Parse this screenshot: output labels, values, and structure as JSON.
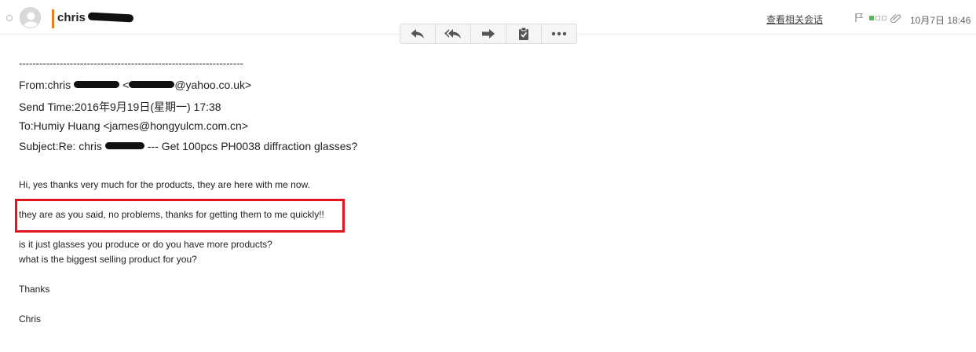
{
  "header": {
    "sender_name": "chris",
    "related_link": "查看相关会话",
    "date": "10月7日 18:46"
  },
  "toolbar": {
    "buttons": [
      {
        "name": "reply",
        "icon": "reply-icon"
      },
      {
        "name": "reply-all",
        "icon": "reply-all-icon"
      },
      {
        "name": "forward",
        "icon": "forward-icon"
      },
      {
        "name": "task",
        "icon": "clipboard-check-icon"
      },
      {
        "name": "more",
        "icon": "more-icon"
      }
    ]
  },
  "quoted": {
    "divider": "------------------------------------------------------------------",
    "from_prefix": "From:chris",
    "from_mid": "<",
    "from_suffix": "@yahoo.co.uk>",
    "send_time": "Send Time:2016年9月19日(星期一) 17:38",
    "to": "To:Humiy Huang <james@hongyulcm.com.cn>",
    "subject_prefix": "Subject:Re: chris",
    "subject_suffix": "--- Get 100pcs PH0038 diffraction glasses?"
  },
  "message": {
    "line1": "Hi, yes thanks very much for the products, they are here with me now.",
    "line2": "they are as you said, no problems, thanks for getting them to me quickly!!",
    "line3": "is it just glasses you produce or do you have more products?",
    "line4": "what is the biggest selling product for you?",
    "line5": "Thanks",
    "line6": "Chris"
  },
  "colors": {
    "accent": "#f07b1e",
    "highlight": "#e1161f",
    "priority_on": "#5cb85c"
  }
}
